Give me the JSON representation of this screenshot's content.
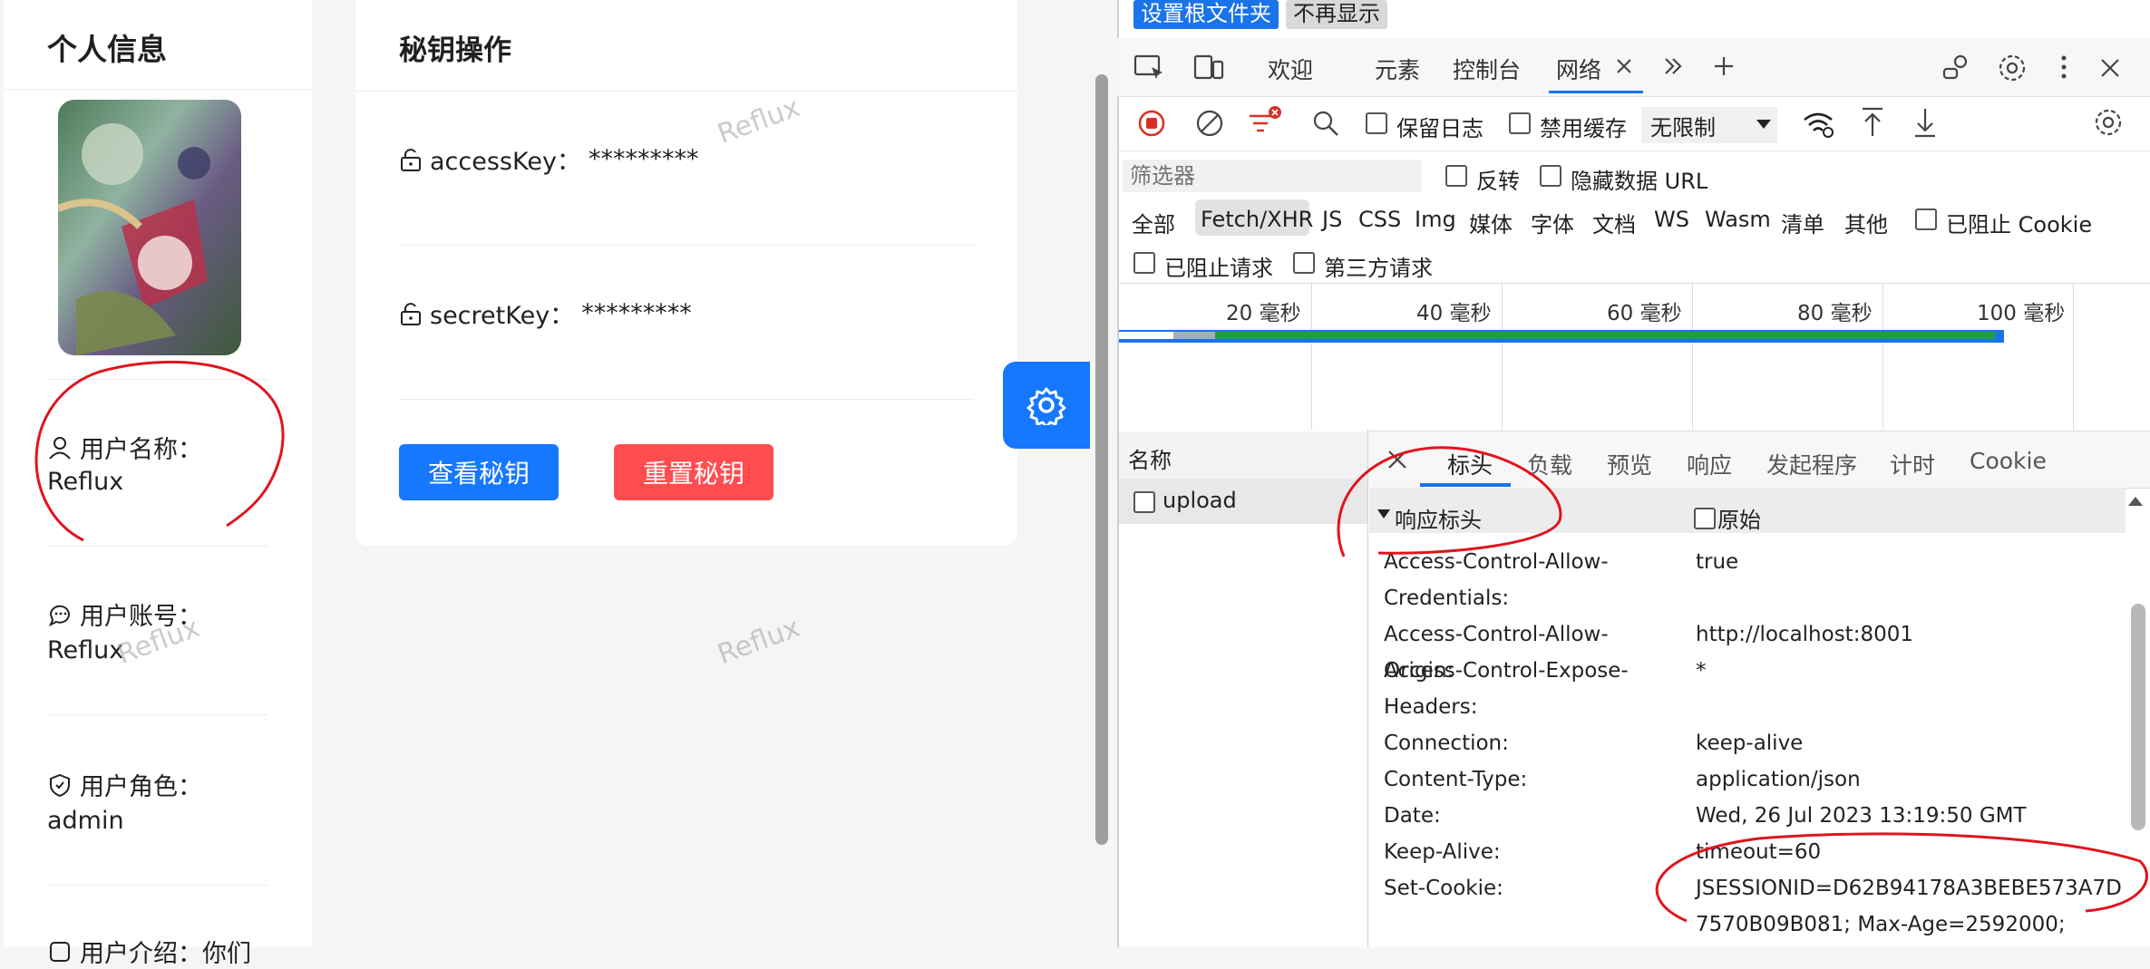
{
  "app": {
    "profile": {
      "title": "个人信息",
      "fields": [
        {
          "label": "用户名称：",
          "value": "Reflux",
          "icon": "user-icon"
        },
        {
          "label": "用户账号：",
          "value": "Reflux",
          "icon": "message-icon"
        },
        {
          "label": "用户角色：",
          "value": "admin",
          "icon": "shield-icon"
        },
        {
          "label": "用户介绍：你们",
          "icon": "profile-icon"
        }
      ]
    },
    "keys": {
      "title": "秘钥操作",
      "access_key_label": "accessKey：",
      "access_key_value": "*********",
      "secret_key_label": "secretKey：",
      "secret_key_value": "*********",
      "view_button": "查看秘钥",
      "reset_button": "重置秘钥"
    },
    "watermark": "Reflux"
  },
  "devtools": {
    "banner": {
      "set_root": "设置根文件夹",
      "dont_show": "不再显示"
    },
    "tabs": [
      "欢迎",
      "元素",
      "控制台",
      "网络"
    ],
    "toolbar": {
      "preserve_log": "保留日志",
      "disable_cache": "禁用缓存",
      "throttle": "无限制"
    },
    "filter": {
      "placeholder": "筛选器",
      "invert": "反转",
      "hide_data_urls": "隐藏数据 URL",
      "types": [
        "全部",
        "Fetch/XHR",
        "JS",
        "CSS",
        "Img",
        "媒体",
        "字体",
        "文档",
        "WS",
        "Wasm",
        "清单",
        "其他"
      ],
      "blocked_cookies": "已阻止 Cookie",
      "blocked_requests": "已阻止请求",
      "third_party": "第三方请求"
    },
    "timeline": {
      "labels": [
        "20 毫秒",
        "40 毫秒",
        "60 毫秒",
        "80 毫秒",
        "100 毫秒"
      ]
    },
    "requests": {
      "header": "名称",
      "items": [
        "upload"
      ]
    },
    "detail_tabs": [
      "标头",
      "负载",
      "预览",
      "响应",
      "发起程序",
      "计时",
      "Cookie"
    ],
    "response_headers": {
      "title": "响应标头",
      "raw_label": "原始",
      "rows": [
        {
          "name": "Access-Control-Allow-",
          "name2": "Credentials:",
          "value": "true"
        },
        {
          "name": "Access-Control-Allow-Origin:",
          "value": "http://localhost:8001"
        },
        {
          "name": "Access-Control-Expose-",
          "name2": "Headers:",
          "value": "*"
        },
        {
          "name": "Connection:",
          "value": "keep-alive"
        },
        {
          "name": "Content-Type:",
          "value": "application/json"
        },
        {
          "name": "Date:",
          "value": "Wed, 26 Jul 2023 13:19:50 GMT"
        },
        {
          "name": "Keep-Alive:",
          "value": "timeout=60"
        },
        {
          "name": "Set-Cookie:",
          "value": "JSESSIONID=D62B94178A3BEBE573A7D",
          "value2": "7570B09B081; Max-Age=2592000;"
        }
      ]
    }
  },
  "colors": {
    "primary": "#1677ff",
    "danger": "#ff4d4f",
    "annotation": "#e0141e",
    "devtools_accent": "#1a73e8"
  }
}
